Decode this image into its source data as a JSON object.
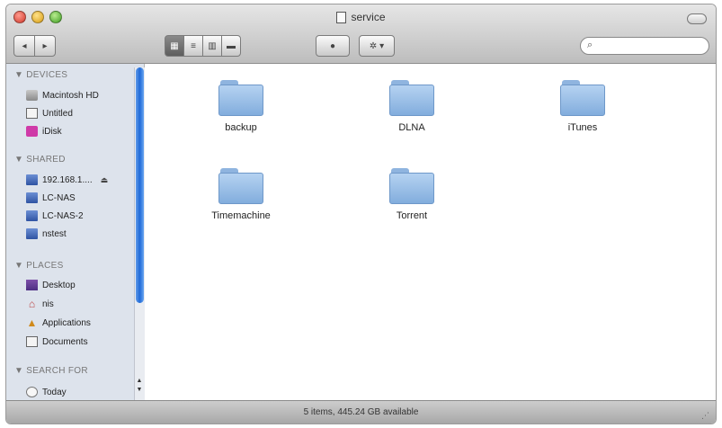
{
  "window": {
    "title": "service"
  },
  "toolbar": {
    "back_label": "◂",
    "forward_label": "▸",
    "view_icon_label": "▦",
    "view_list_label": "≡",
    "view_column_label": "▥",
    "view_coverflow_label": "▬",
    "quicklook_label": "●",
    "action_label": "✲ ▾",
    "search_glyph": "⌕",
    "search_placeholder": ""
  },
  "sidebar": {
    "devices_header": "▼ DEVICES",
    "devices": [
      "Macintosh HD",
      "Untitled",
      "iDisk"
    ],
    "shared_header": "▼ SHARED",
    "shared": [
      "192.168.1....",
      "LC-NAS",
      "LC-NAS-2",
      "nstest"
    ],
    "eject": "⏏",
    "places_header": "▼ PLACES",
    "places": [
      "Desktop",
      "nis",
      "Applications",
      "Documents"
    ],
    "search_header": "▼ SEARCH FOR",
    "search": [
      "Today"
    ]
  },
  "files": [
    {
      "name": "backup"
    },
    {
      "name": "DLNA"
    },
    {
      "name": "iTunes"
    },
    {
      "name": "Timemachine"
    },
    {
      "name": "Torrent"
    }
  ],
  "status": {
    "text": "5 items, 445.24 GB available",
    "grip": "⋰"
  }
}
